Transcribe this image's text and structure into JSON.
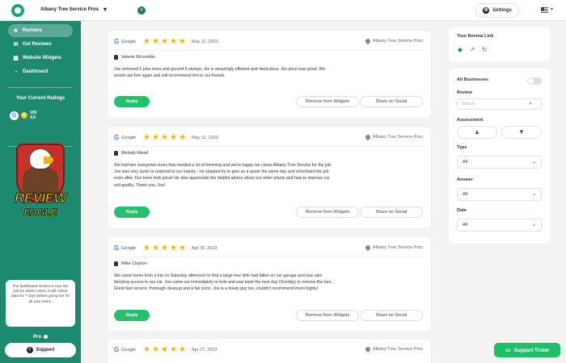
{
  "topbar": {
    "business_name": "Albany Tree Service Pros",
    "business_caret": "▾",
    "add_symbol": "+",
    "settings_label": "Settings",
    "language_caret": "▾"
  },
  "sidebar": {
    "nav": [
      {
        "label": "Reviews",
        "icon": "star-icon",
        "glyph": "★"
      },
      {
        "label": "Get Reviews",
        "icon": "send-icon",
        "glyph": "✉"
      },
      {
        "label": "Website Widgets",
        "icon": "grid-icon",
        "glyph": "▦"
      },
      {
        "label": "Dashboard",
        "icon": "pie-icon",
        "glyph": "◔"
      }
    ],
    "ratings_title": "Your Current Ratings",
    "google_count": "100",
    "google_rating": "4.9",
    "logo_text_1": "REVIEW",
    "logo_text_2": "EAGLE",
    "notice": "The dashboard section is now live just for admin users. It will collect data for 7 days before going live for all your users.",
    "pro_label": "Pro",
    "support_label": "Support"
  },
  "reviews": [
    {
      "source": "Google",
      "stars": 5,
      "date": "May 11, 2023",
      "business": "Albany Tree Service Pros",
      "reviewer": "Valerie Mccombs",
      "text": "Joe removed 5 pine trees and ground 6 stumps. He is amazingly efficient and meticulous. His price was great. We would use him again and will recommend him to our friends.",
      "reply_label": "Reply",
      "remove_label": "Remove from Widgets",
      "share_label": "Share on Social"
    },
    {
      "source": "Google",
      "stars": 5,
      "date": "May 11, 2023",
      "business": "Albany Tree Service Pros",
      "reviewer": "Melody Mead",
      "text": "We had two overgrown trees that needed a lot of trimming and we're happy we chose Albany Tree Service for the job. Joe was very quick to respond to our inquiry - he stopped by to give us a quote the same day and scheduled the job soon after. Our trees look great! He also appreciate the helpful advice about our other plants and how to improve our soil quality. Thank you, Joe!",
      "reply_label": "Reply",
      "remove_label": "Remove from Widgets",
      "share_label": "Share on Social"
    },
    {
      "source": "Google",
      "stars": 5,
      "date": "Apr 30, 2023",
      "business": "Albany Tree Service Pros",
      "reviewer": "Mike Clayton",
      "text": "We came home from a trip on Saturday afternoon to find a large tree limb had fallen on our garage and was also blocking access to our car. Joe came out immediately to look and was back the next day (Sunday) to remove the tree. Great fast service, thorough cleanup and a fair price. Joe is a lovely guy too, couldn't recommend more highly!",
      "reply_label": "Reply",
      "remove_label": "Remove from Widgets",
      "share_label": "Share on Social"
    },
    {
      "source": "Google",
      "stars": 5,
      "date": "Apr 27, 2023",
      "business": "Albany Tree Service Pros"
    }
  ],
  "review_link_panel": {
    "title": "Your Review Link"
  },
  "filters": {
    "all_businesses_label": "All Businesses",
    "review_label": "Review",
    "search_placeholder": "Search",
    "assessment_label": "Assessment",
    "type_label": "Type",
    "type_value": "All",
    "answer_label": "Answer",
    "answer_value": "All",
    "date_label": "Date",
    "date_value": "All"
  },
  "support_ticket_label": "Support Ticket",
  "colors": {
    "sidebar_green": "#1e8a6d",
    "reply_green": "#22c16b",
    "star_yellow": "#f4b400",
    "ticket_green": "#1fbf69"
  }
}
